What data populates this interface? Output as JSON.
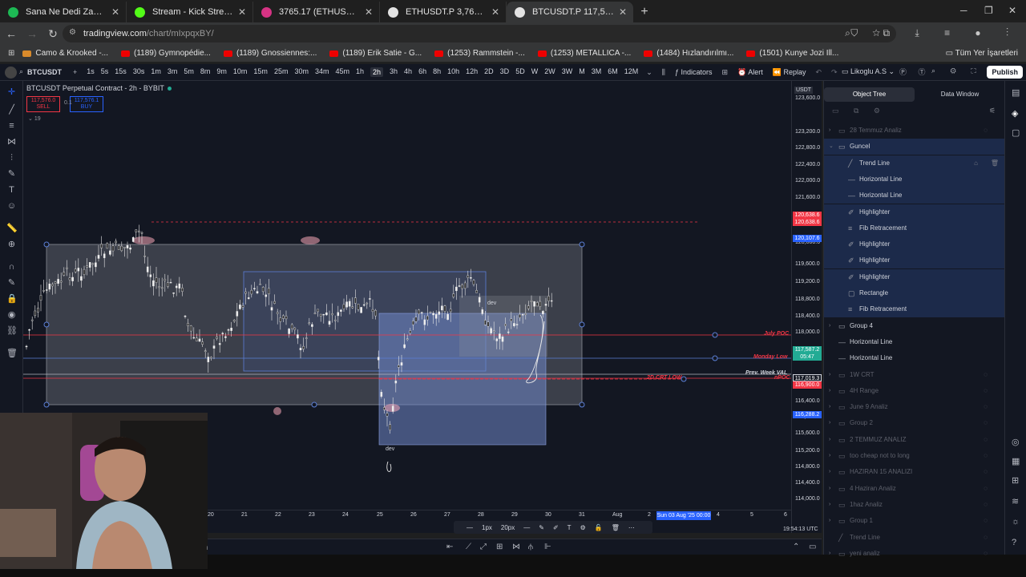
{
  "browser": {
    "tabs": [
      {
        "label": "Sana Ne Dedi Zaman • Dec",
        "favicon_color": "#1db954",
        "active": false
      },
      {
        "label": "Stream - Kick Streaming",
        "favicon_color": "#53fc18",
        "active": false
      },
      {
        "label": "3765.17 (ETHUSD) - Exocharts",
        "favicon_color": "#d63384",
        "active": false
      },
      {
        "label": "ETHUSDT.P 3,766.05 ▼ −0.81%",
        "favicon_color": "#e3e3e3",
        "active": false
      },
      {
        "label": "BTCUSDT.P 117,587.2 ▼ −0.41%",
        "favicon_color": "#e3e3e3",
        "active": true
      }
    ],
    "url_host": "tradingview.com",
    "url_path": "/chart/mIxpqxBY/",
    "bookmarks": [
      "Camo & Krooked -...",
      "(1189) Gymnopédie...",
      "(1189) Gnossiennes:...",
      "(1189) Erik Satie - G...",
      "(1253) Rammstein -...",
      "(1253) METALLICA -...",
      "(1484) Hızlandırılmı...",
      "(1501) Kunye Jozi Ill..."
    ],
    "bookmarks_all": "Tüm Yer İşaretleri"
  },
  "toolbar": {
    "symbol": "BTCUSDT",
    "timeframes": [
      "1s",
      "5s",
      "15s",
      "30s",
      "1m",
      "3m",
      "5m",
      "8m",
      "9m",
      "10m",
      "15m",
      "25m",
      "30m",
      "34m",
      "45m",
      "1h",
      "2h",
      "3h",
      "4h",
      "6h",
      "8h",
      "10h",
      "12h",
      "2D",
      "3D",
      "5D",
      "W",
      "2W",
      "3W",
      "M",
      "3M",
      "6M",
      "12M"
    ],
    "active_timeframe": "2h",
    "indicators": "Indicators",
    "alert": "Alert",
    "replay": "Replay",
    "layout_name": "Likoglu A.S",
    "publish": "Publish"
  },
  "chart": {
    "title": "BTCUSDT Perpetual Contract - 2h - BYBIT",
    "sell_price": "117,576.0",
    "sell_label": "SELL",
    "spread": "0.1",
    "buy_price": "117,576.1",
    "buy_label": "BUY",
    "indicator_count": "19",
    "currency": "USDT",
    "price_labels": [
      "123,600.0",
      "123,200.0",
      "122,800.0",
      "122,400.0",
      "122,000.0",
      "121,600.0",
      "121,200.0",
      "120,000.0",
      "119,600.0",
      "119,200.0",
      "118,800.0",
      "118,400.0",
      "118,000.0",
      "116,400.0",
      "116,000.0",
      "115,600.0",
      "115,200.0",
      "114,800.0",
      "114,400.0",
      "114,000.0"
    ],
    "price_tags": [
      {
        "text": "120,638.6",
        "color": "#f23645"
      },
      {
        "text": "120,638.6",
        "color": "#f23645"
      },
      {
        "text": "120,107.6",
        "color": "#2962ff"
      },
      {
        "text": "117,587.2",
        "color": "#22ab94"
      },
      {
        "text": "117,019.3",
        "color": "#131722"
      },
      {
        "text": "116,900.0",
        "color": "#f23645"
      },
      {
        "text": "116,288.2",
        "color": "#2962ff"
      }
    ],
    "countdown": "05:47",
    "date_labels": [
      "20",
      "21",
      "22",
      "23",
      "24",
      "25",
      "26",
      "27",
      "28",
      "29",
      "30",
      "31",
      "Aug",
      "2",
      "4",
      "5",
      "6"
    ],
    "crosshair_date": "Sun 03 Aug '25   00:00",
    "clock": "19:54:13 UTC",
    "levels": {
      "july_poc": "July POC",
      "monday_low": "Monday Low",
      "prev_week_val": "Prev. Week VAL",
      "npoc": "nPOC",
      "crt_low": "2D CRT LOW"
    },
    "box_labels": [
      "dev",
      "dev"
    ],
    "float_toolbar": [
      "1px",
      "20px"
    ]
  },
  "panel": {
    "tab_object_tree": "Object Tree",
    "tab_data_window": "Data Window",
    "rows": [
      {
        "label": "28 Temmuz Analiz",
        "type": "folder",
        "dim": true,
        "indent": 0
      },
      {
        "label": "Guncel",
        "type": "folder-open",
        "dim": false,
        "indent": 0,
        "selected": true
      },
      {
        "label": "Trend Line",
        "type": "trend",
        "dim": false,
        "indent": 1,
        "selected": true
      },
      {
        "label": "Horizontal Line",
        "type": "hline",
        "dim": false,
        "indent": 1,
        "selected": true
      },
      {
        "label": "Horizontal Line",
        "type": "hline",
        "dim": false,
        "indent": 1,
        "selected": true
      },
      {
        "label": "Highlighter",
        "type": "brush",
        "dim": false,
        "indent": 1,
        "selected": true
      },
      {
        "label": "Fib Retracement",
        "type": "fib",
        "dim": false,
        "indent": 1,
        "selected": true
      },
      {
        "label": "Highlighter",
        "type": "brush",
        "dim": false,
        "indent": 1,
        "selected": true
      },
      {
        "label": "Highlighter",
        "type": "brush",
        "dim": false,
        "indent": 1,
        "selected": true
      },
      {
        "label": "Highlighter",
        "type": "brush",
        "dim": false,
        "indent": 1,
        "selected": true
      },
      {
        "label": "Rectangle",
        "type": "rect",
        "dim": false,
        "indent": 1,
        "selected": true
      },
      {
        "label": "Fib Retracement",
        "type": "fib",
        "dim": false,
        "indent": 1,
        "selected": true
      },
      {
        "label": "Group 4",
        "type": "folder",
        "dim": false,
        "indent": 0
      },
      {
        "label": "Horizontal Line",
        "type": "hline",
        "dim": false,
        "indent": 0
      },
      {
        "label": "Horizontal Line",
        "type": "hline",
        "dim": false,
        "indent": 0
      },
      {
        "label": "1W CRT",
        "type": "folder",
        "dim": true,
        "indent": 0
      },
      {
        "label": "4H Range",
        "type": "folder",
        "dim": true,
        "indent": 0
      },
      {
        "label": "June 9 Analiz",
        "type": "folder",
        "dim": true,
        "indent": 0
      },
      {
        "label": "Group 2",
        "type": "folder",
        "dim": true,
        "indent": 0
      },
      {
        "label": "2 TEMMUZ ANALIZ",
        "type": "folder",
        "dim": true,
        "indent": 0
      },
      {
        "label": "too cheap not to long",
        "type": "folder",
        "dim": true,
        "indent": 0
      },
      {
        "label": "HAZIRAN 15 ANALIZI",
        "type": "folder",
        "dim": true,
        "indent": 0
      },
      {
        "label": "4 Haziran Analiz",
        "type": "folder",
        "dim": true,
        "indent": 0
      },
      {
        "label": "1haz Analiz",
        "type": "folder",
        "dim": true,
        "indent": 0
      },
      {
        "label": "Group 1",
        "type": "folder",
        "dim": true,
        "indent": 0
      },
      {
        "label": "Trend Line",
        "type": "trend",
        "dim": true,
        "indent": 0
      },
      {
        "label": "yeni analiz",
        "type": "folder",
        "dim": true,
        "indent": 0
      }
    ]
  },
  "bottom": {
    "webcam_caption": "net"
  }
}
